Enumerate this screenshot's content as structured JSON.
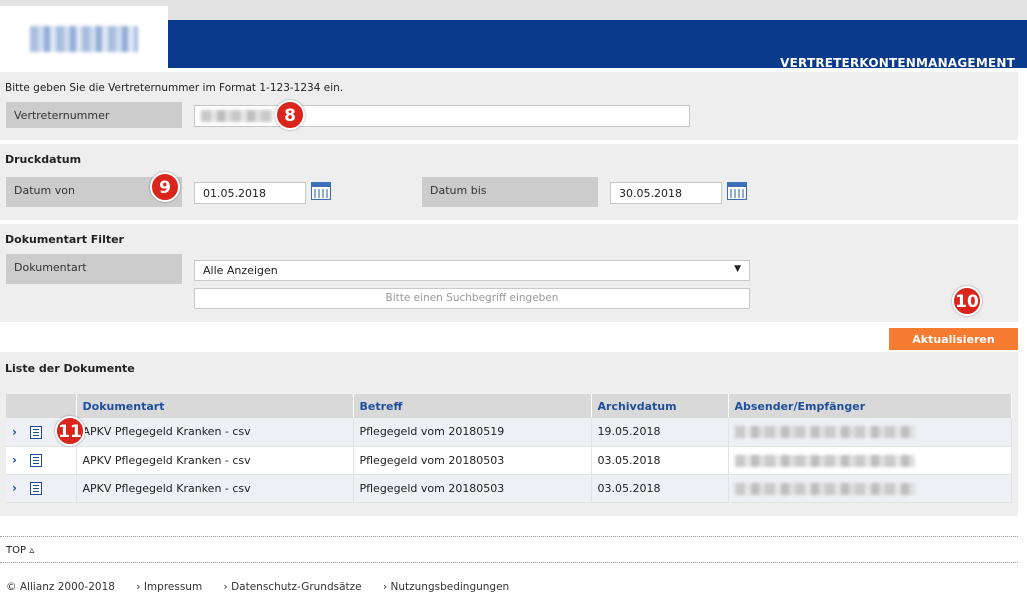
{
  "header": {
    "title": "VERTRETERKONTENMANAGEMENT"
  },
  "agent_section": {
    "hint": "Bitte geben Sie die Vertreternummer im Format 1-123-1234 ein.",
    "label": "Vertreternummer",
    "annotation": "8"
  },
  "date_section": {
    "title": "Druckdatum",
    "from_label": "Datum von",
    "from_value": "01.05.2018",
    "to_label": "Datum bis",
    "to_value": "30.05.2018",
    "annotation": "9"
  },
  "doc_filter": {
    "title": "Dokumentart Filter",
    "label": "Dokumentart",
    "selected": "Alle Anzeigen",
    "search_placeholder": "Bitte einen Suchbegriff eingeben"
  },
  "refresh": {
    "label": "Aktualisieren",
    "annotation": "10"
  },
  "list": {
    "title": "Liste der Dokumente",
    "columns": [
      "Dokumentart",
      "Betreff",
      "Archivdatum",
      "Absender/Empfänger"
    ],
    "annotation": "11",
    "rows": [
      {
        "expand": "›",
        "doctype": "APKV Pflegegeld Kranken - csv",
        "subject": "Pflegegeld vom 20180519",
        "date": "19.05.2018"
      },
      {
        "expand": "›",
        "doctype": "APKV Pflegegeld Kranken - csv",
        "subject": "Pflegegeld vom 20180503",
        "date": "03.05.2018"
      },
      {
        "expand": "›",
        "doctype": "APKV Pflegegeld Kranken - csv",
        "subject": "Pflegegeld vom 20180503",
        "date": "03.05.2018"
      }
    ]
  },
  "top_link": "TOP ▵",
  "footer": {
    "copyright": "© Allianz 2000-2018",
    "links": [
      "› Impressum",
      "› Datenschutz-Grundsätze",
      "› Nutzungsbedingungen"
    ]
  }
}
